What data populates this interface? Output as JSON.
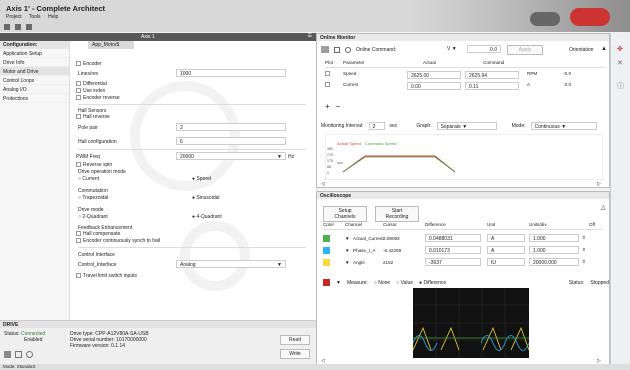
{
  "app": {
    "title": "Axis 1' - Complete Architect",
    "menu": [
      "Project",
      "Tools",
      "Help"
    ],
    "window_controls": "— □ ×"
  },
  "axis": {
    "label": "Axis 1",
    "collapse": "☰"
  },
  "nav": {
    "header": "Configuration:",
    "items": [
      "Application Setup",
      "Drive Info",
      "Motor and Drive",
      "Control Loops",
      "Analog I/O",
      "Protections"
    ],
    "selected": "Motor and Drive"
  },
  "config": {
    "tab": "App_Motor$",
    "encoder_label": "Encoder",
    "lines_rev_label": "Lines/rev",
    "lines_rev_value": "1000",
    "differential_label": "Differential",
    "use_index_label": "Use index",
    "encoder_reverse_label": "Encoder reverse",
    "hall_sensors_label": "Hall Sensors",
    "hall_reverse_label": "Hall reverse",
    "pole_pair_label": "Pole pair",
    "pole_pair_value": "2",
    "hall_config_label": "Hall configuration",
    "hall_config_value": "6",
    "pwm_label": "PWM Freq",
    "pwm_value": "20000",
    "pwm_unit": "Hz",
    "reverse_spin_label": "Reverse spin",
    "drive_op_mode_label": "Drive operation mode",
    "op_current": "Current",
    "op_speed": "Speed",
    "commutation_label": "Commutation",
    "comm_trap": "Trapezoidal",
    "comm_sin": "Sinusoidal",
    "drive_mode_label": "Drive mode",
    "dm_2q": "2-Quadrant",
    "dm_4q": "4-Quadrant",
    "feedback_label": "Feedback Enhancement",
    "hall_comp_label": "Hall compensate",
    "enc_cont_label": "Encoder continuously synch to hall",
    "control_iface_label": "Control Interface",
    "control_iface_field": "Control_Interface",
    "control_iface_value": "Analog",
    "travel_limit_label": "Travel limit switch inputs"
  },
  "drive": {
    "header": "DRIVE",
    "status_label": "Status:",
    "status_value": "Connected",
    "enabled": "Enabled",
    "type_label": "Drive type:",
    "type_value": "CPP-A12V80A-SA-USB",
    "serial_label": "Drive serial number:",
    "serial_value": "10170000000",
    "fw_label": "Firmware version:",
    "fw_value": "0.1.14",
    "read_btn": "Read",
    "write_btn": "Write"
  },
  "status_bar": {
    "mode_label": "Mode:",
    "mode_value": "Standard"
  },
  "online": {
    "header": "Online Monitor",
    "cmd_label": "Online Command:",
    "cmd_value": "0.0",
    "cmd_unit": "V",
    "apply": "Apply",
    "orientation": "Orientation",
    "cols": [
      "Plot",
      "Parameter",
      "Actual",
      "Command",
      ""
    ],
    "rows": [
      {
        "name": "Speed",
        "actual": "2625.00",
        "command": "2625.94",
        "unit": "RPM",
        "extra": "-0.0"
      },
      {
        "name": "Current",
        "actual": "0.00",
        "command": "0.11",
        "unit": "A",
        "extra": "0.0"
      }
    ],
    "mon_interval_label": "Monitoring Interval:",
    "mon_interval_value": "2",
    "mon_unit": "sec",
    "graph_label": "Graph:",
    "graph_value": "Separate",
    "mode_label": "Mode:",
    "mode_value": "Continuous",
    "legend_actual": "Actual Speed",
    "legend_cmd": "Command Speed",
    "y_ticks": [
      "350",
      "2?5",
      "175",
      "88",
      "0"
    ],
    "y_label": "rpm"
  },
  "scope": {
    "header": "Oscilloscope",
    "setup_btn": "Setup Channels",
    "record_btn": "Start Recording",
    "cols": [
      "Color",
      "Channel",
      "Cursor",
      "Difference",
      "Unit",
      "Units/div",
      "Off"
    ],
    "channels": [
      {
        "color": "#4caf50",
        "name": "Actual_Current",
        "cursor": "2.09093",
        "diff": "0.0488031",
        "unit": "A",
        "div": "1.000"
      },
      {
        "color": "#29b6f6",
        "name": "Phase_I_A",
        "cursor": "-6.42299",
        "diff": "0.010173",
        "unit": "A",
        "div": "1.000"
      },
      {
        "color": "#fdd835",
        "name": "Angle",
        "cursor": "2162",
        "diff": "-3637",
        "unit": "IU",
        "div": "20000.000"
      }
    ],
    "measure_label": "Measure:",
    "m_none": "None",
    "m_value": "Value",
    "m_diff": "Difference",
    "status_label": "Status:",
    "status_value": "Stopped"
  },
  "colors": {
    "accent": "#c62828",
    "trace_red": "#e53935",
    "trace_green": "#43a047",
    "scope_green": "#43a047",
    "scope_blue": "#29b6f6",
    "scope_yellow": "#fdd835"
  },
  "chart_data": [
    {
      "type": "line",
      "series": [
        {
          "name": "Actual Speed",
          "color": "#e53935"
        },
        {
          "name": "Command Speed",
          "color": "#43a047"
        }
      ]
    }
  ]
}
